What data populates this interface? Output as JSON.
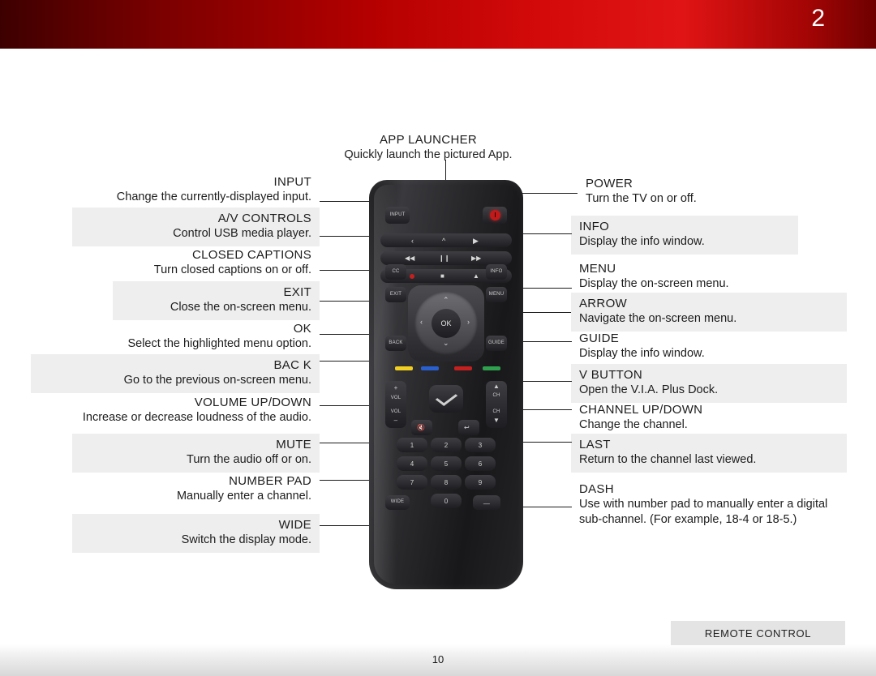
{
  "header": {
    "page_number": "2"
  },
  "footer": {
    "section_tab": "REMOTE CONTROL",
    "page_number": "10"
  },
  "top_callout": {
    "title": "APP LAUNCHER",
    "desc": "Quickly launch the pictured App."
  },
  "left_callouts": [
    {
      "title": "INPUT",
      "desc": "Change the currently-displayed input.",
      "shaded": false
    },
    {
      "title": "A/V CONTROLS",
      "desc": "Control USB media player.",
      "shaded": true
    },
    {
      "title": "CLOSED CAPTIONS",
      "desc": "Turn closed captions on or off.",
      "shaded": false
    },
    {
      "title": "EXIT",
      "desc": "Close the on-screen menu.",
      "shaded": true
    },
    {
      "title": "OK",
      "desc": "Select the highlighted menu option.",
      "shaded": false
    },
    {
      "title": "BAC K",
      "desc": "Go to the previous on-screen menu.",
      "shaded": true
    },
    {
      "title": "VOLUME UP/DOWN",
      "desc": "Increase or decrease loudness of the audio.",
      "shaded": false
    },
    {
      "title": "MUTE",
      "desc": "Turn the audio off or on.",
      "shaded": true
    },
    {
      "title": "NUMBER PAD",
      "desc": "Manually enter a channel.",
      "shaded": false
    },
    {
      "title": "WIDE",
      "desc": "Switch the display mode.",
      "shaded": true
    }
  ],
  "right_callouts": [
    {
      "title": "POWER",
      "desc": "Turn the TV on or off.",
      "shaded": false
    },
    {
      "title": "INFO",
      "desc": "Display the info window.",
      "shaded": true
    },
    {
      "title": "MENU",
      "desc": "Display the on-screen menu.",
      "shaded": false
    },
    {
      "title": "ARROW",
      "desc": "Navigate the on-screen menu.",
      "shaded": true
    },
    {
      "title": "GUIDE",
      "desc": "Display the info window.",
      "shaded": false
    },
    {
      "title": "V BUTTON",
      "desc": "Open the V.I.A. Plus Dock.",
      "shaded": true
    },
    {
      "title": "CHANNEL UP/DOWN",
      "desc": "Change the channel.",
      "shaded": false
    },
    {
      "title": "LAST",
      "desc": "Return to the channel last viewed.",
      "shaded": true
    },
    {
      "title": "DASH",
      "desc": "Use with number pad to manually enter a digital sub-channel. (For example, 18-4 or 18-5.)",
      "shaded": false
    }
  ],
  "remote": {
    "labels": {
      "input": "INPUT",
      "cc": "CC",
      "info": "INFO",
      "exit": "EXIT",
      "menu": "MENU",
      "back": "BACK",
      "guide": "GUIDE",
      "ok": "OK",
      "vol_up": "VOL",
      "vol_down": "VOL",
      "ch_up": "CH",
      "ch_down": "CH",
      "wide": "WIDE"
    },
    "numpad": [
      "1",
      "2",
      "3",
      "4",
      "5",
      "6",
      "7",
      "8",
      "9",
      "0"
    ],
    "accent_color": "#c01a1a"
  }
}
